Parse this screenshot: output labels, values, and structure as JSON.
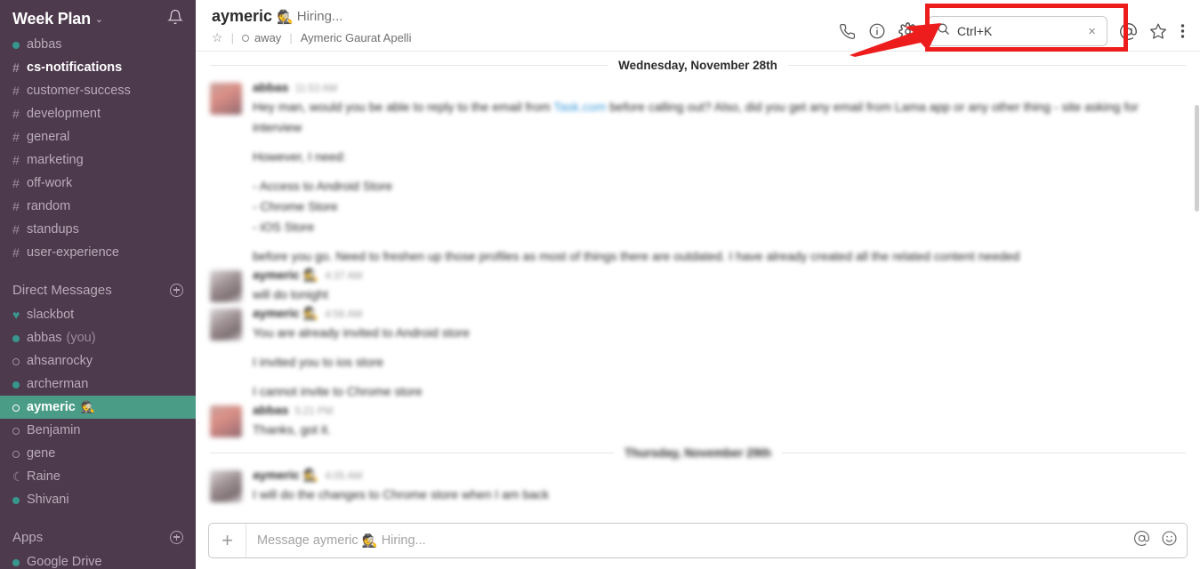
{
  "sidebar": {
    "workspace": {
      "name": "Week Plan",
      "chevron": "⌄",
      "bell_icon": "bell-icon"
    },
    "channels": [
      {
        "prefix": "dot-online",
        "label": "abbas",
        "state": "read"
      },
      {
        "prefix": "#",
        "label": "cs-notifications",
        "state": "unread"
      },
      {
        "prefix": "#",
        "label": "customer-success",
        "state": "read"
      },
      {
        "prefix": "#",
        "label": "development",
        "state": "read"
      },
      {
        "prefix": "#",
        "label": "general",
        "state": "read"
      },
      {
        "prefix": "#",
        "label": "marketing",
        "state": "read"
      },
      {
        "prefix": "#",
        "label": "off-work",
        "state": "read"
      },
      {
        "prefix": "#",
        "label": "random",
        "state": "read"
      },
      {
        "prefix": "#",
        "label": "standups",
        "state": "read"
      },
      {
        "prefix": "#",
        "label": "user-experience",
        "state": "read"
      }
    ],
    "dm_section": {
      "label": "Direct Messages",
      "add_icon": "plus-circle-icon"
    },
    "dms": [
      {
        "prefix": "heart",
        "label": "slackbot",
        "sub": "",
        "state": "read"
      },
      {
        "prefix": "dot-online",
        "label": "abbas",
        "sub": "(you)",
        "state": "read"
      },
      {
        "prefix": "ring-away",
        "label": "ahsanrocky",
        "sub": "",
        "state": "dim"
      },
      {
        "prefix": "dot-online",
        "label": "archerman",
        "sub": "",
        "state": "read"
      },
      {
        "prefix": "ring-away",
        "label": "aymeric",
        "sub": "",
        "emoji": "🕵️",
        "state": "active"
      },
      {
        "prefix": "ring-away",
        "label": "Benjamin",
        "sub": "",
        "state": "dim"
      },
      {
        "prefix": "ring-away",
        "label": "gene",
        "sub": "",
        "state": "dim"
      },
      {
        "prefix": "dnd",
        "label": "Raine",
        "sub": "",
        "state": "dim"
      },
      {
        "prefix": "dot-online",
        "label": "Shivani",
        "sub": "",
        "state": "read"
      }
    ],
    "apps_section": {
      "label": "Apps",
      "add_icon": "plus-circle-icon"
    },
    "apps": [
      {
        "prefix": "dot-online",
        "label": "Google Drive",
        "state": "read"
      }
    ]
  },
  "header": {
    "title": "aymeric",
    "title_emoji": "🕵️",
    "topic": "Hiring...",
    "star_icon": "star-outline-icon",
    "presence": "away",
    "full_name": "Aymeric Gaurat Apelli",
    "icons": [
      "phone-icon",
      "info-icon",
      "gear-icon",
      "mention-icon",
      "star-icon",
      "kebab-menu-icon"
    ]
  },
  "search": {
    "value": "Ctrl+K",
    "placeholder": "Search",
    "search_icon": "search-icon",
    "clear_icon": "clear-icon"
  },
  "annotation": {
    "highlight_color": "#ee1d1d",
    "target": "search-box",
    "shape": "rectangle-and-arrow"
  },
  "messages": {
    "divider_1": "Wednesday, November 28th",
    "divider_2": "Thursday, November 29th",
    "groups": [
      {
        "author": "abbas",
        "avatar": "pink",
        "timestamp": "11:53 AM",
        "lines": [
          {
            "text": "Hey man, would you be able to reply to the email from ",
            "link": "Task.com",
            "rest": " before calling out? Also, did you get any email from Lama app or any other thing - site asking for"
          },
          {
            "text": "interview"
          },
          {
            "text": "However, I need:",
            "gap": true
          },
          {
            "text": "- Access to Android Store",
            "gap": true
          },
          {
            "text": "- Chrome Store"
          },
          {
            "text": "- iOS Store"
          },
          {
            "text": "before you go. Need to freshen up those profiles as most of things there are outdated. I have already created all the related content needed",
            "gap": true
          }
        ]
      },
      {
        "author": "aymeric",
        "avatar": "grey",
        "emoji": "🕵️",
        "timestamp": "4:37 AM",
        "lines": [
          {
            "text": "will do tonight"
          }
        ]
      },
      {
        "author": "aymeric",
        "avatar": "grey",
        "emoji": "🕵️",
        "timestamp": "4:56 AM",
        "lines": [
          {
            "text": "You are already invited to Android store"
          },
          {
            "text": "I invited you to ios store",
            "gap": true
          },
          {
            "text": "I cannot invite to Chrome store",
            "gap": true
          }
        ]
      },
      {
        "author": "abbas",
        "avatar": "pink",
        "timestamp": "5:21 PM",
        "lines": [
          {
            "text": "Thanks, got it."
          }
        ]
      },
      {
        "author": "aymeric",
        "avatar": "grey",
        "emoji": "🕵️",
        "timestamp": "4:05 AM",
        "after_divider": true,
        "lines": [
          {
            "text": "I will do the changes to Chrome store when I am back"
          }
        ]
      }
    ]
  },
  "composer": {
    "plus_icon": "plus-icon",
    "placeholder_prefix": "Message aymeric",
    "placeholder_emoji": "🕵️",
    "placeholder_suffix": "Hiring...",
    "mention_icon": "mention-icon",
    "emoji_icon": "emoji-icon"
  }
}
